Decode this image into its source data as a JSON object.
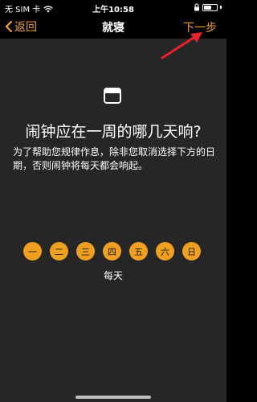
{
  "status_bar": {
    "carrier": "无 SIM 卡",
    "time": "上午10:58"
  },
  "nav": {
    "back_label": "返回",
    "title": "就寝",
    "next_label": "下一步"
  },
  "content": {
    "question": "闹钟应在一周的哪几天响?",
    "explanation": "为了帮助您规律作息，除非您取消选择下方的日期，否则闹钟将每天都会响起。",
    "days": [
      "一",
      "二",
      "三",
      "四",
      "五",
      "六",
      "日"
    ],
    "repeat_summary": "每天"
  },
  "colors": {
    "accent": "#f0a030",
    "day_circle": "#f0a020",
    "background": "#262626",
    "annotation_arrow": "#e8222a"
  },
  "icons": [
    "wifi-icon",
    "battery-icon",
    "lock-icon",
    "chevron-left-icon",
    "calendar-icon"
  ]
}
